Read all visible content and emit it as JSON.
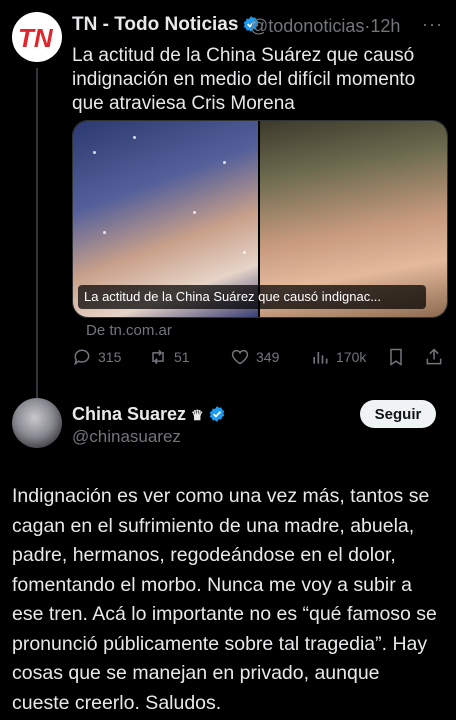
{
  "top_tweet": {
    "author_name": "TN - Todo Noticias",
    "handle": "@todonoticias",
    "separator": "·",
    "time": "12h",
    "more": "···",
    "text": "La actitud de la China Suárez que causó indignación en medio del difícil momento que atraviesa Cris Morena",
    "card_caption": "La actitud de la China Suárez que causó indignac...",
    "source": "De tn.com.ar",
    "replies": "315",
    "reposts": "51",
    "likes": "349",
    "views": "170k",
    "logo_text": "TN"
  },
  "quoted_tweet": {
    "author_name": "China Suarez",
    "crown": "♛",
    "handle": "@chinasuarez",
    "follow_label": "Seguir",
    "text": "Indignación es ver como una vez más, tantos se cagan en el sufrimiento de una madre, abuela, padre, hermanos, regodeándose en el dolor, fomentando el morbo. Nunca me voy a subir a ese tren. Acá lo importante no es “qué famoso se pronunció públicamente sobre tal tragedia”. Hay cosas que se manejan en privado, aunque cueste creerlo. Saludos."
  },
  "colors": {
    "background": "#000000",
    "verified": "#1d9bf0",
    "tn_logo": "#e0262c",
    "muted": "#71767b"
  },
  "icons": [
    "reply-icon",
    "repost-icon",
    "like-icon",
    "views-icon",
    "bookmark-icon",
    "share-icon",
    "verified-icon",
    "more-icon"
  ]
}
